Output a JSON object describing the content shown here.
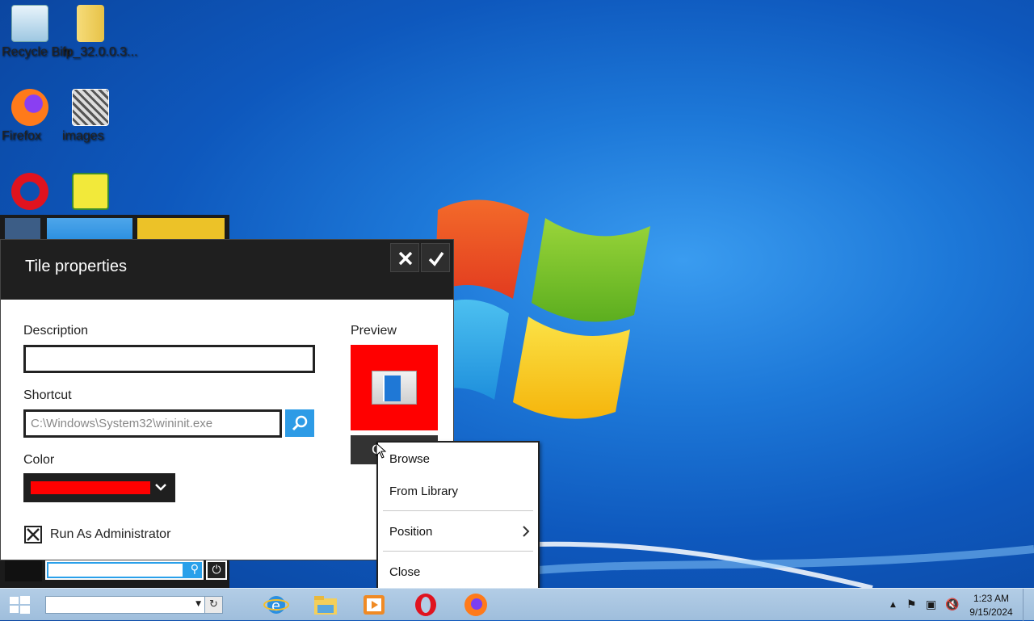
{
  "desktop": {
    "icons": [
      {
        "label": "Recycle Bin",
        "icon": "recycle-bin-icon"
      },
      {
        "label": "fp_32.0.0.3...",
        "icon": "zip-folder-icon"
      },
      {
        "label": "Firefox",
        "icon": "firefox-icon"
      },
      {
        "label": "images",
        "icon": "image-thumbnail-icon"
      },
      {
        "label": "",
        "icon": "opera-icon"
      },
      {
        "label": "",
        "icon": "spongebob-icon"
      }
    ]
  },
  "dialog": {
    "title": "Tile properties",
    "description_label": "Description",
    "description_value": "",
    "shortcut_label": "Shortcut",
    "shortcut_value": "C:\\Windows\\System32\\wininit.exe",
    "color_label": "Color",
    "color_value": "#ff0000",
    "run_as_admin_label": "Run As Administrator",
    "run_as_admin_checked": true,
    "preview_label": "Preview",
    "preview_bg": "#ff0000",
    "change_button_label": "C"
  },
  "context_menu": {
    "items": [
      "Browse",
      "From Library",
      "Position",
      "Close"
    ]
  },
  "taskbar": {
    "address_value": "",
    "pinned": [
      "internet-explorer-icon",
      "file-explorer-icon",
      "media-player-icon",
      "opera-icon",
      "firefox-icon"
    ],
    "clock_time": "1:23 AM",
    "clock_date": "9/15/2024"
  }
}
